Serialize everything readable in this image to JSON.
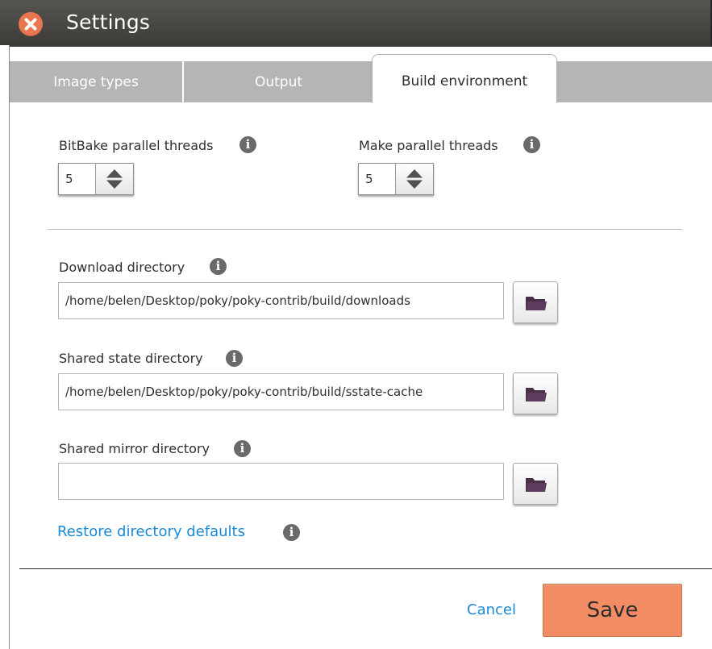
{
  "window": {
    "title": "Settings",
    "close_icon": "close-x-icon",
    "close_color": "#e9764f"
  },
  "tabs": [
    {
      "label": "Image types",
      "active": false
    },
    {
      "label": "Output",
      "active": false
    },
    {
      "label": "Build environment",
      "active": true
    }
  ],
  "threads": {
    "bitbake": {
      "label": "BitBake parallel threads",
      "value": "5"
    },
    "make": {
      "label": "Make parallel threads",
      "value": "5"
    }
  },
  "directories": {
    "download": {
      "label": "Download directory",
      "value": "/home/belen/Desktop/poky/poky-contrib/build/downloads"
    },
    "sstate": {
      "label": "Shared state directory",
      "value": "/home/belen/Desktop/poky/poky-contrib/build/sstate-cache"
    },
    "mirror": {
      "label": "Shared mirror directory",
      "value": ""
    }
  },
  "info_glyph": "i",
  "restore_link": "Restore directory defaults",
  "footer": {
    "cancel_label": "Cancel",
    "save_label": "Save",
    "save_color": "#f28c65"
  },
  "colors": {
    "link": "#1a8ad6",
    "titlebar": "#45433f",
    "tab_inactive": "#b5b5b5"
  }
}
